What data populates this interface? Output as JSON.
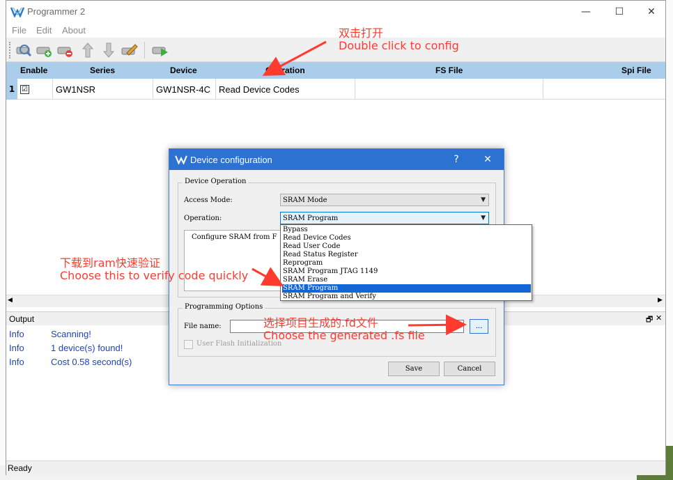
{
  "window": {
    "title": "Programmer 2",
    "minimize": "—",
    "maximize": "☐",
    "close": "✕"
  },
  "menu": [
    "File",
    "Edit",
    "About"
  ],
  "table": {
    "columns": [
      "Enable",
      "Series",
      "Device",
      "Operation",
      "FS File",
      "Spi File"
    ],
    "rows": [
      {
        "num": "1",
        "enable": "☑",
        "series": "GW1NSR",
        "device": "GW1NSR-4C",
        "operation": "Read Device Codes",
        "fs_file": "",
        "spi_file": ""
      }
    ]
  },
  "output": {
    "title": "Output",
    "logs": [
      {
        "type": "Info",
        "msg": "Scanning!"
      },
      {
        "type": "Info",
        "msg": "1 device(s) found!"
      },
      {
        "type": "Info",
        "msg": "Cost 0.58 second(s)"
      }
    ]
  },
  "status": "Ready",
  "dialog": {
    "title": "Device configuration",
    "help": "?",
    "close": "✕",
    "device_operation_label": "Device Operation",
    "access_mode_label": "Access Mode:",
    "access_mode_value": "SRAM Mode",
    "operation_label": "Operation:",
    "operation_value": "SRAM Program",
    "description": "Configure SRAM from F",
    "programming_options_label": "Programming Options",
    "file_name_label": "File name:",
    "file_name_value": "",
    "browse": "...",
    "user_flash_label": "User Flash Initialization",
    "save": "Save",
    "cancel": "Cancel",
    "operation_options": [
      "Bypass",
      "Read Device Codes",
      "Read User Code",
      "Read Status Register",
      "Reprogram",
      "SRAM Program JTAG 1149",
      "SRAM Erase",
      "SRAM Program",
      "SRAM Program and Verify"
    ],
    "selected_index": 7
  },
  "annotations": {
    "a1_zh": "双击打开",
    "a1_en": "Double click to config",
    "a2_zh": "下载到ram快速验证",
    "a2_en": "Choose this to verify code quickly",
    "a3_zh": "选择项目生成的.fd文件",
    "a3_en": "Choose the generated .fs file"
  },
  "colors": {
    "header_blue": "#a9cdeb",
    "dialog_title": "#2c72d0",
    "log_blue": "#1e3fcf",
    "annotation_red": "#ff3b2f",
    "selection": "#1366d6"
  },
  "icons": [
    "app-logo-icon",
    "scan-device-icon",
    "add-device-icon",
    "remove-device-icon",
    "move-up-icon",
    "move-down-icon",
    "edit-icon",
    "program-icon"
  ]
}
